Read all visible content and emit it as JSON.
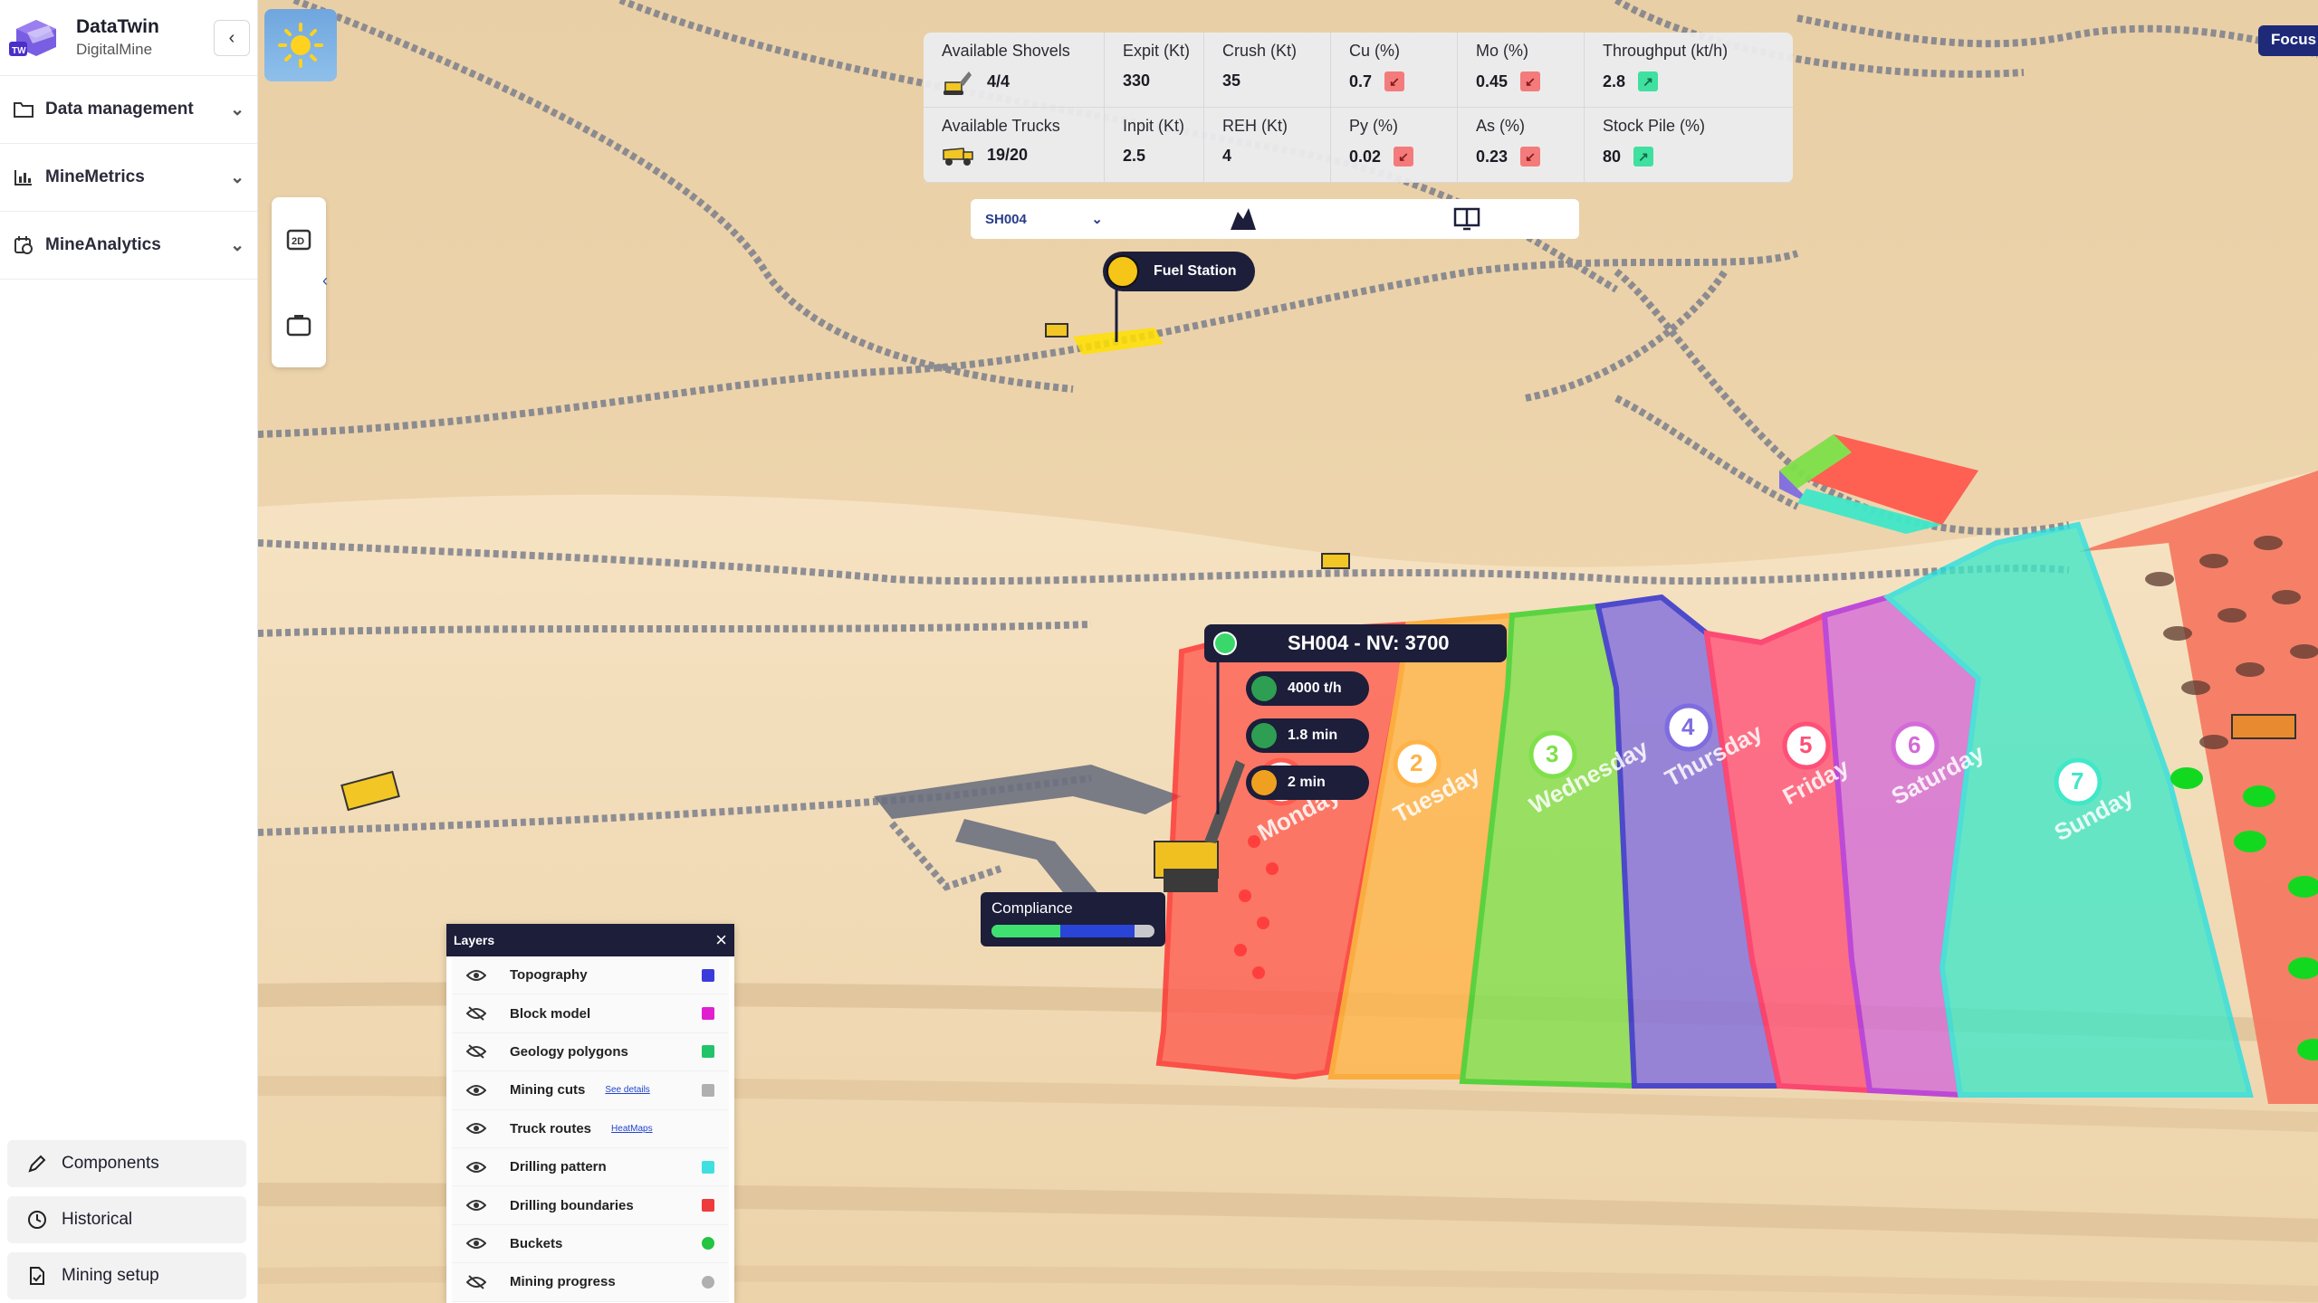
{
  "brand": {
    "name": "DataTwin",
    "sub": "DigitalMine",
    "logo_text": "TW"
  },
  "sidebar": {
    "items": [
      {
        "label": "Data management",
        "icon": "folder-icon"
      },
      {
        "label": "MineMetrics",
        "icon": "bar-chart-icon"
      },
      {
        "label": "MineAnalytics",
        "icon": "calendar-analytics-icon"
      }
    ],
    "bottom": [
      {
        "label": "Components",
        "icon": "pencil-icon"
      },
      {
        "label": "Historical",
        "icon": "clock-icon"
      },
      {
        "label": "Mining setup",
        "icon": "document-icon"
      }
    ]
  },
  "metrics": {
    "row1": [
      {
        "label": "Available Shovels",
        "value": "4/4",
        "icon": "excavator-icon"
      },
      {
        "label": "Expit (Kt)",
        "value": "330"
      },
      {
        "label": "Crush (Kt)",
        "value": "35"
      },
      {
        "label": "Cu (%)",
        "value": "0.7",
        "trend": "down"
      },
      {
        "label": "Mo (%)",
        "value": "0.45",
        "trend": "down"
      },
      {
        "label": "Throughput (kt/h)",
        "value": "2.8",
        "trend": "up"
      }
    ],
    "row2": [
      {
        "label": "Available Trucks",
        "value": "19/20",
        "icon": "truck-icon"
      },
      {
        "label": "Inpit (Kt)",
        "value": "2.5"
      },
      {
        "label": "REH (Kt)",
        "value": "4"
      },
      {
        "label": "Py (%)",
        "value": "0.02",
        "trend": "down"
      },
      {
        "label": "As (%)",
        "value": "0.23",
        "trend": "down"
      },
      {
        "label": "Stock Pile (%)",
        "value": "80",
        "trend": "up"
      }
    ]
  },
  "shovel_selector": {
    "value": "SH004"
  },
  "focus_button": "Focus",
  "fuel_station": "Fuel Station",
  "shovel_tag": {
    "title": "SH004 - NV: 3700"
  },
  "shovel_stats": [
    "4000 t/h",
    "1.8 min",
    "2 min"
  ],
  "compliance": {
    "title": "Compliance",
    "progress": 0.42,
    "planned": 0.88
  },
  "weekdays": [
    {
      "num": "1",
      "day": "Monday",
      "color": "#ff5a4e"
    },
    {
      "num": "2",
      "day": "Tuesday",
      "color": "#ffb347"
    },
    {
      "num": "3",
      "day": "Wednesday",
      "color": "#7fe04a"
    },
    {
      "num": "4",
      "day": "Thursday",
      "color": "#7f6ce0"
    },
    {
      "num": "5",
      "day": "Friday",
      "color": "#ff5077"
    },
    {
      "num": "6",
      "day": "Saturday",
      "color": "#d46ad8"
    },
    {
      "num": "7",
      "day": "Sunday",
      "color": "#40e8c8"
    }
  ],
  "layers": {
    "title": "Layers",
    "items": [
      {
        "name": "Topography",
        "visible": true,
        "color": "#3b3bdc"
      },
      {
        "name": "Block model",
        "visible": false,
        "color": "#e020d0"
      },
      {
        "name": "Geology polygons",
        "visible": false,
        "color": "#22c46a"
      },
      {
        "name": "Mining cuts",
        "visible": true,
        "color": "#b0b0b0",
        "link": "See details"
      },
      {
        "name": "Truck routes",
        "visible": true,
        "color": "",
        "link": "HeatMaps"
      },
      {
        "name": "Drilling pattern",
        "visible": true,
        "color": "#40e0e0"
      },
      {
        "name": "Drilling boundaries",
        "visible": true,
        "color": "#ee3b3b"
      },
      {
        "name": "Buckets",
        "visible": true,
        "color": "#22c440",
        "round": true
      },
      {
        "name": "Mining progress",
        "visible": false,
        "color": "#b0b0b0",
        "round": true
      }
    ]
  }
}
